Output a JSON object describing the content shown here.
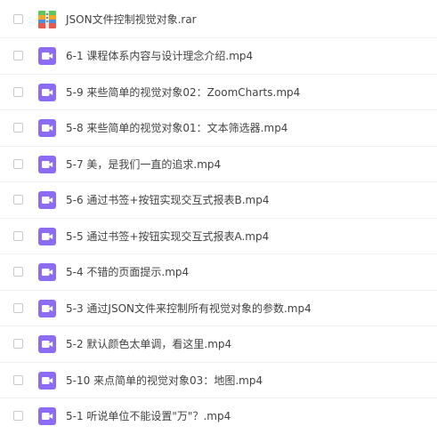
{
  "files": [
    {
      "name": "JSON文件控制视觉对象.rar",
      "icon": "archive-icon"
    },
    {
      "name": "6-1 课程体系内容与设计理念介绍.mp4",
      "icon": "video-icon"
    },
    {
      "name": "5-9 来些简单的视觉对象02：ZoomCharts.mp4",
      "icon": "video-icon"
    },
    {
      "name": "5-8 来些简单的视觉对象01：文本筛选器.mp4",
      "icon": "video-icon"
    },
    {
      "name": "5-7 美，是我们一直的追求.mp4",
      "icon": "video-icon"
    },
    {
      "name": "5-6 通过书签+按钮实现交互式报表B.mp4",
      "icon": "video-icon"
    },
    {
      "name": "5-5 通过书签+按钮实现交互式报表A.mp4",
      "icon": "video-icon"
    },
    {
      "name": "5-4 不错的页面提示.mp4",
      "icon": "video-icon"
    },
    {
      "name": "5-3 通过JSON文件来控制所有视觉对象的参数.mp4",
      "icon": "video-icon"
    },
    {
      "name": "5-2 默认颜色太单调，看这里.mp4",
      "icon": "video-icon"
    },
    {
      "name": "5-10 来点简单的视觉对象03：地图.mp4",
      "icon": "video-icon"
    },
    {
      "name": "5-1 听说单位不能设置\"万\"？.mp4",
      "icon": "video-icon"
    }
  ],
  "colors": {
    "video_icon": "#8b6cf2",
    "archive_green": "#5cc85a",
    "archive_orange": "#f5a623",
    "archive_blue": "#4a90e2",
    "archive_red": "#e8584c"
  }
}
